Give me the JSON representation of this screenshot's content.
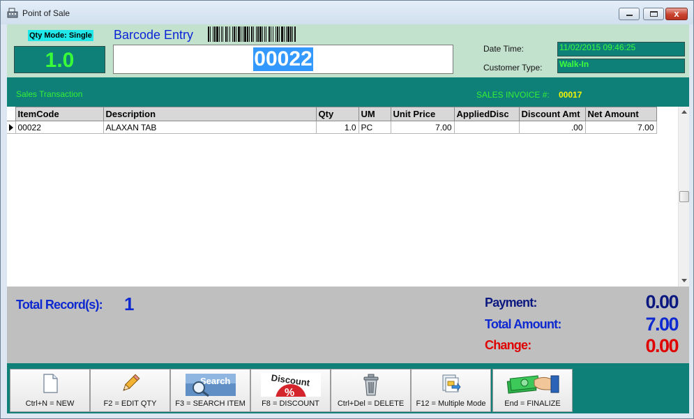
{
  "window": {
    "title": "Point of Sale",
    "close_glyph": "x"
  },
  "header": {
    "qty_mode": "Qty Mode: Single",
    "qty_value": "1.0",
    "barcode_label": "Barcode Entry",
    "barcode_value": "00022",
    "date_time_label": "Date Time:",
    "date_time_value": "11/02/2015 09:46:25",
    "customer_type_label": "Customer Type:",
    "customer_type_value": "Walk-In"
  },
  "sales_bar": {
    "title": "Sales Transaction",
    "invoice_label": "SALES INVOICE #:",
    "invoice_value": "00017"
  },
  "grid": {
    "columns": [
      "ItemCode",
      "Description",
      "Qty",
      "UM",
      "Unit Price",
      "AppliedDisc",
      "Discount Amt",
      "Net Amount"
    ],
    "rows": [
      [
        "00022",
        "ALAXAN TAB",
        "1.0",
        "PC",
        "7.00",
        "",
        ".00",
        "7.00"
      ]
    ]
  },
  "totals": {
    "records_label": "Total Record(s):",
    "records_value": "1",
    "payment_label": "Payment:",
    "payment_value": "0.00",
    "total_label": "Total Amount:",
    "total_value": "7.00",
    "change_label": "Change:",
    "change_value": "0.00"
  },
  "toolbar": {
    "buttons": [
      {
        "label": "Ctrl+N = NEW",
        "icon": "new-document-icon"
      },
      {
        "label": "F2 = EDIT QTY",
        "icon": "pencil-icon"
      },
      {
        "label": "F3 = SEARCH ITEM",
        "icon": "search-icon",
        "icon_text": "Search"
      },
      {
        "label": "F8 = DISCOUNT",
        "icon": "discount-icon",
        "icon_text": "Discount",
        "icon_symbol": "%"
      },
      {
        "label": "Ctrl+Del = DELETE",
        "icon": "trash-icon"
      },
      {
        "label": "F12 = Multiple Mode",
        "icon": "multiple-mode-icon"
      },
      {
        "label": "End = FINALIZE",
        "icon": "cash-payment-icon"
      }
    ]
  },
  "colors": {
    "teal": "#0f8078",
    "header_green": "#c3e2cd",
    "neon_green": "#35f035",
    "highlight_yellow": "#f7f700",
    "blue": "#0e29d0",
    "navy": "#0b1880",
    "red": "#e00000",
    "totals_gray": "#bfbfbf"
  }
}
